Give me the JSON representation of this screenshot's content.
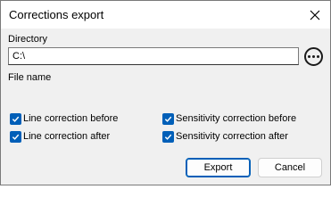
{
  "window": {
    "title": "Corrections export"
  },
  "directory": {
    "label": "Directory",
    "value": "C:\\"
  },
  "filename": {
    "label": "File name"
  },
  "options": {
    "line_before": {
      "label": "Line correction before",
      "checked": true
    },
    "line_after": {
      "label": "Line correction after",
      "checked": true
    },
    "sens_before": {
      "label": "Sensitivity correction before",
      "checked": true
    },
    "sens_after": {
      "label": "Sensitivity correction after",
      "checked": true
    }
  },
  "buttons": {
    "export_label": "Export",
    "cancel_label": "Cancel"
  },
  "icons": {
    "close": "close-icon",
    "browse": "more-icon",
    "checkmark": "checkmark-icon"
  },
  "colors": {
    "accent": "#005fb8",
    "client_bg": "#f0f0f0",
    "titlebar_bg": "#ffffff"
  }
}
